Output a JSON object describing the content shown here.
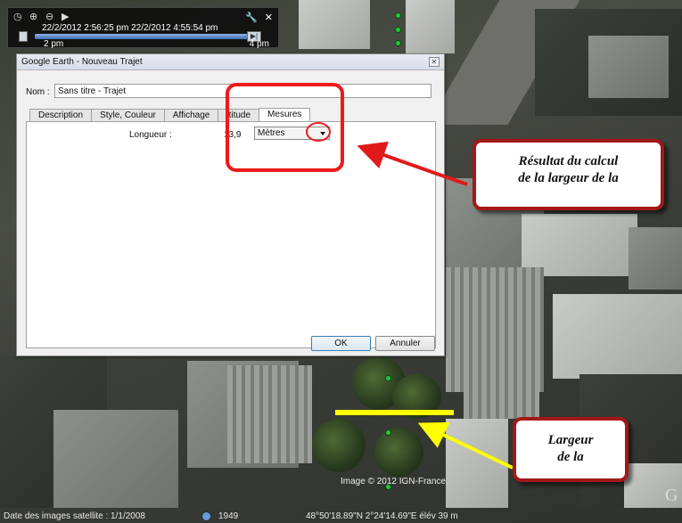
{
  "timebar": {
    "range": "22/2/2012  2:56:25 pm  22/2/2012  4:55:54 pm",
    "start_label": "2 pm",
    "end_label": "4 pm"
  },
  "dialog": {
    "title": "Google Earth - Nouveau Trajet",
    "name_label": "Nom :",
    "name_value": "Sans titre - Trajet",
    "tabs": [
      "Description",
      "Style, Couleur",
      "Affichage",
      "ltitude",
      "Mesures"
    ],
    "length_label": "Longueur :",
    "length_value": "13,9",
    "unit": "Mètres",
    "ok_label": "OK",
    "cancel_label": "Annuler"
  },
  "callouts": {
    "result": [
      "Résultat du calcul",
      "de la largeur de la"
    ],
    "width": [
      "Largeur",
      "de la"
    ]
  },
  "map": {
    "copyright": "Image © 2012 IGN-France",
    "logo_text": "G"
  },
  "status": {
    "imagery_date": "Date des images satellite : 1/1/2008",
    "year": "1949",
    "coords": "48°50'18.89\"N   2°24'14.69\"E  élév   39 m"
  },
  "colors": {
    "highlight_red": "#ee1a1a",
    "callout_border": "#a31818",
    "measure_line": "#ffff00",
    "path_marker": "#29c23d"
  }
}
